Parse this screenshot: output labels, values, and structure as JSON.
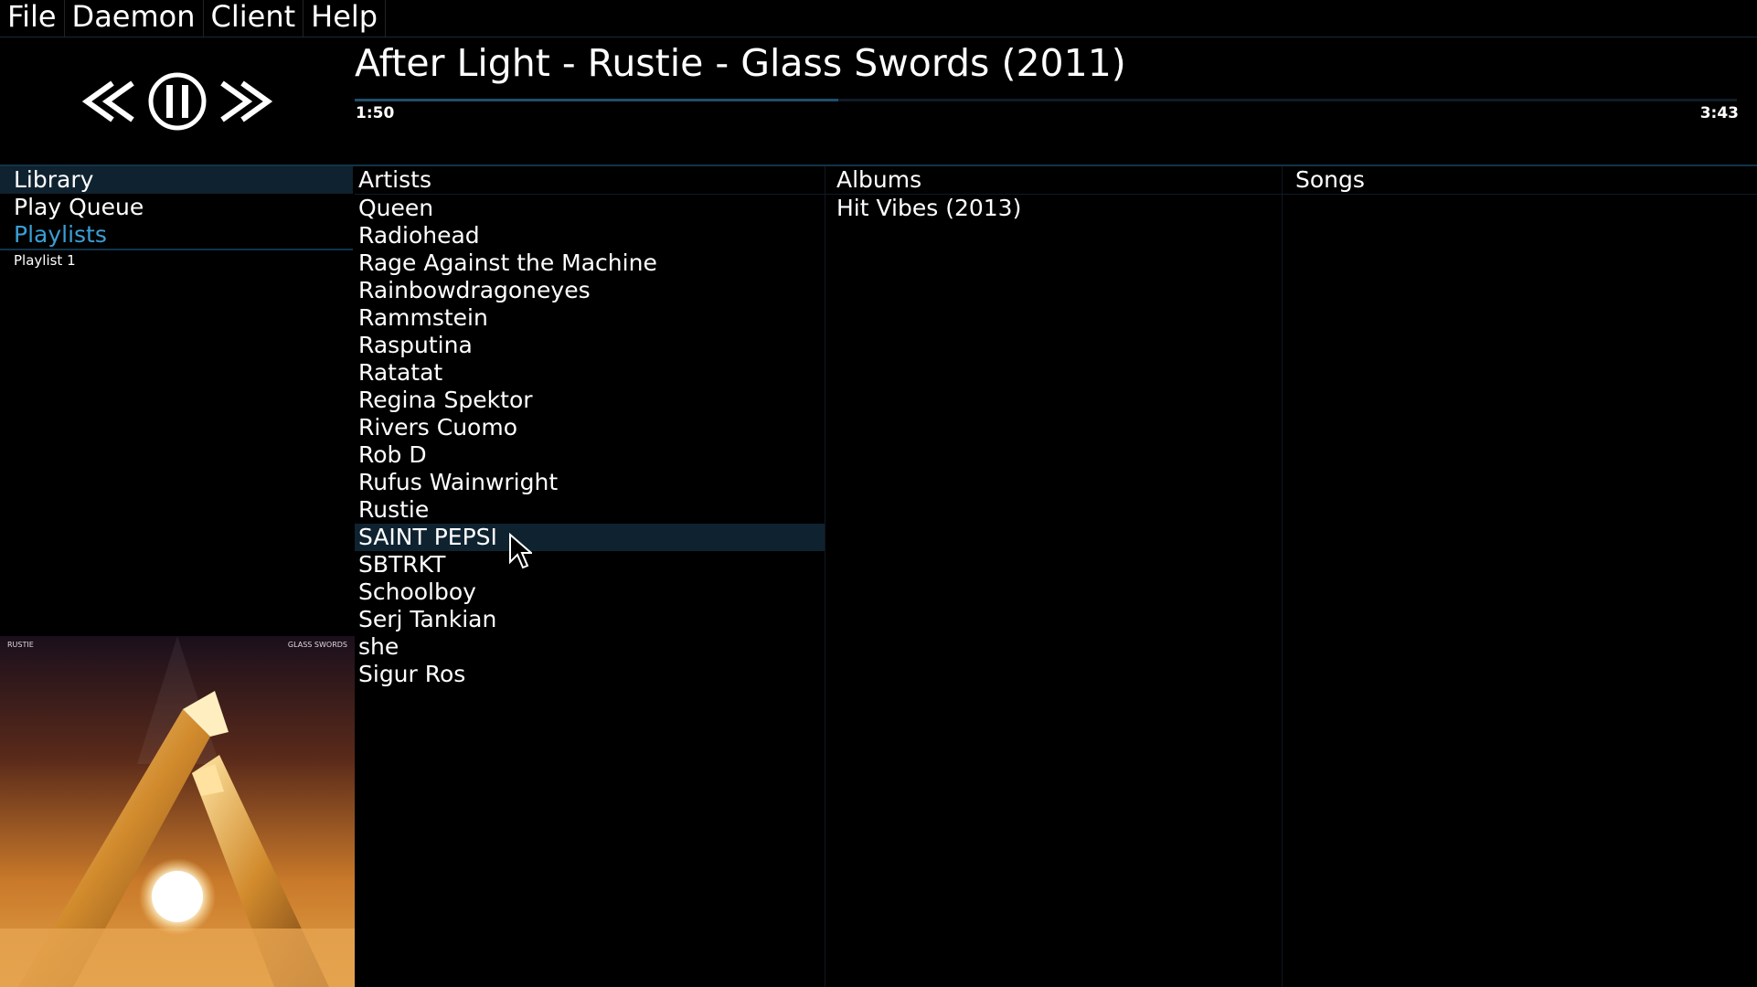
{
  "menu": [
    "File",
    "Daemon",
    "Client",
    "Help"
  ],
  "player": {
    "now_playing": "After Light - Rustie - Glass Swords (2011)",
    "elapsed": "1:50",
    "total": "3:43",
    "progress_fraction": 0.35
  },
  "nav": {
    "library": "Library",
    "play_queue": "Play Queue",
    "playlists": "Playlists",
    "playlist_items": [
      "Playlist 1"
    ]
  },
  "columns": {
    "artists": {
      "header": "Artists",
      "items": [
        "Queen",
        "Radiohead",
        "Rage Against the Machine",
        "Rainbowdragoneyes",
        "Rammstein",
        "Rasputina",
        "Ratatat",
        "Regina Spektor",
        "Rivers Cuomo",
        "Rob D",
        "Rufus Wainwright",
        "Rustie",
        "SAINT PEPSI",
        "SBTRKT",
        "Schoolboy",
        "Serj Tankian",
        "she",
        "Sigur Ros"
      ],
      "selected_index": 12
    },
    "albums": {
      "header": "Albums",
      "items": [
        "Hit Vibes (2013)"
      ]
    },
    "songs": {
      "header": "Songs",
      "items": []
    }
  },
  "album_art": {
    "top_left_text": "RUSTIE",
    "top_right_text": "GLASS SWORDS"
  },
  "colors": {
    "accent": "#3a9fd6",
    "selection": "#0f2230",
    "background": "#000000"
  }
}
